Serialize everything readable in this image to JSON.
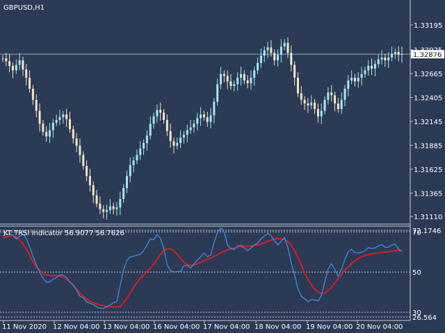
{
  "window": {
    "symbol_label": "GBPUSD,H1"
  },
  "colors": {
    "background": "#2b3a55",
    "axis": "#c8cdd6",
    "candle_up": "#a8e6ee",
    "candle_down": "#f3e6c6",
    "tsi_line": "#3f8de6",
    "signal_line": "#e11b1b",
    "price_line": "#9aa3b0"
  },
  "price_panel": {
    "current_price": "1.32876",
    "y_ticks": [
      "1.33195",
      "1.32925",
      "1.32665",
      "1.32405",
      "1.32145",
      "1.31885",
      "1.31625",
      "1.31365",
      "1.31110"
    ]
  },
  "indicator_panel": {
    "title": "KT TRSI Indicator 56.9077 56.7626",
    "y_ticks": [
      "72.1746",
      "70",
      "50",
      "30",
      "26.564"
    ],
    "levels": [
      70,
      50,
      30
    ]
  },
  "x_axis": {
    "labels": [
      "11 Nov 2020",
      "12 Nov 04:00",
      "13 Nov 04:00",
      "16 Nov 04:00",
      "17 Nov 04:00",
      "18 Nov 04:00",
      "19 Nov 04:00",
      "20 Nov 04:00"
    ]
  },
  "chart_data": [
    {
      "type": "candlestick",
      "title": "GBPUSD,H1",
      "ylim": [
        1.3105,
        1.333
      ],
      "current_price": 1.32876,
      "close": [
        1.3283,
        1.328,
        1.3275,
        1.327,
        1.3276,
        1.3281,
        1.3271,
        1.3262,
        1.325,
        1.3238,
        1.3226,
        1.3212,
        1.3203,
        1.3198,
        1.3205,
        1.3213,
        1.3216,
        1.3219,
        1.3222,
        1.3217,
        1.3206,
        1.3196,
        1.3188,
        1.3178,
        1.3166,
        1.3155,
        1.3145,
        1.3134,
        1.3125,
        1.3119,
        1.3116,
        1.3118,
        1.3122,
        1.3119,
        1.3121,
        1.313,
        1.3142,
        1.3155,
        1.3167,
        1.3172,
        1.3178,
        1.3185,
        1.3191,
        1.3199,
        1.3212,
        1.322,
        1.3227,
        1.3224,
        1.3216,
        1.3204,
        1.3193,
        1.3188,
        1.3191,
        1.3197,
        1.32,
        1.3205,
        1.3208,
        1.3212,
        1.3218,
        1.3222,
        1.3219,
        1.3214,
        1.3221,
        1.3236,
        1.3255,
        1.3266,
        1.3264,
        1.3258,
        1.3253,
        1.3255,
        1.3262,
        1.3266,
        1.3259,
        1.3256,
        1.3262,
        1.327,
        1.3278,
        1.3286,
        1.3292,
        1.3295,
        1.3289,
        1.3281,
        1.3287,
        1.3296,
        1.33,
        1.3289,
        1.3276,
        1.3262,
        1.3245,
        1.3238,
        1.3234,
        1.3232,
        1.3235,
        1.3228,
        1.322,
        1.3226,
        1.3238,
        1.3246,
        1.3243,
        1.3234,
        1.3228,
        1.3238,
        1.325,
        1.3259,
        1.3262,
        1.3258,
        1.3262,
        1.3266,
        1.327,
        1.3275,
        1.3272,
        1.3277,
        1.3282,
        1.3284,
        1.3281,
        1.3284,
        1.3288,
        1.329,
        1.3287,
        1.3288
      ]
    },
    {
      "type": "line",
      "title": "KT TRSI Indicator 56.9077 56.7626",
      "ylim": [
        26.564,
        72.1746
      ],
      "levels": [
        70,
        50,
        30
      ],
      "series": [
        {
          "values": [
            68.0,
            68.7,
            69.1,
            68.4,
            66.5,
            67.7,
            69.0,
            66.8,
            62.6,
            57.9,
            53.5,
            50.0,
            47.0,
            44.9,
            45.0,
            46.5,
            47.2,
            48.6,
            48.5,
            47.4,
            45.0,
            43.7,
            41.0,
            38.0,
            37.2,
            35.2,
            34.4,
            33.9,
            32.6,
            32.0,
            31.9,
            32.6,
            33.6,
            34.8,
            35.2,
            43.3,
            51.1,
            55.8,
            57.5,
            57.9,
            58.4,
            58.9,
            60.6,
            63.4,
            66.5,
            66.1,
            68.7,
            66.8,
            62.0,
            53.6,
            50.7,
            50.1,
            50.2,
            50.3,
            53.2,
            53.3,
            52.0,
            54.0,
            56.0,
            57.6,
            59.5,
            57.7,
            58.5,
            64.6,
            69.7,
            72.0,
            69.9,
            63.5,
            61.6,
            61.3,
            63.1,
            63.4,
            62.0,
            60.6,
            62.0,
            63.5,
            64.5,
            66.6,
            67.9,
            69.2,
            68.1,
            65.6,
            63.5,
            65.3,
            67.2,
            62.2,
            54.6,
            48.8,
            41.5,
            37.9,
            36.7,
            35.3,
            36.3,
            36.1,
            35.6,
            38.3,
            45.2,
            51.4,
            54.2,
            51.2,
            47.8,
            51.5,
            56.2,
            60.1,
            61.4,
            59.7,
            59.5,
            59.9,
            60.6,
            62.2,
            61.7,
            62.0,
            63.0,
            63.6,
            62.4,
            62.4,
            63.5,
            63.9,
            61.4,
            60.3
          ]
        },
        {
          "values": [
            67.0,
            67.5,
            68.0,
            68.2,
            67.3,
            66.0,
            64.2,
            61.5,
            58.4,
            55.0,
            52.5,
            50.7,
            49.4,
            48.6,
            48.2,
            48.2,
            48.3,
            48.1,
            47.4,
            46.4,
            45.0,
            43.3,
            41.5,
            39.6,
            38.0,
            36.6,
            35.5,
            34.7,
            34.1,
            33.6,
            33.3,
            33.0,
            32.7,
            32.6,
            32.5,
            32.9,
            34.6,
            37.1,
            39.6,
            42.3,
            44.8,
            46.9,
            48.6,
            50.2,
            51.9,
            53.8,
            56.3,
            58.8,
            60.7,
            61.6,
            61.5,
            60.6,
            58.8,
            56.7,
            54.9,
            53.7,
            53.3,
            53.5,
            54.1,
            54.8,
            55.6,
            56.4,
            57.1,
            57.8,
            58.7,
            59.6,
            60.4,
            61.1,
            61.7,
            62.0,
            62.3,
            62.6,
            62.8,
            62.9,
            63.0,
            63.2,
            63.5,
            64.0,
            64.6,
            65.3,
            65.9,
            66.4,
            66.7,
            66.6,
            66.2,
            65.2,
            63.4,
            60.7,
            57.3,
            53.6,
            49.8,
            46.5,
            43.6,
            41.5,
            40.0,
            39.4,
            39.6,
            40.8,
            42.6,
            44.6,
            46.8,
            48.9,
            50.8,
            52.6,
            54.2,
            55.6,
            56.8,
            57.6,
            58.3,
            58.7,
            59.0,
            59.3,
            59.5,
            59.8,
            60.0,
            60.2,
            60.4,
            60.6,
            60.7,
            60.8
          ]
        }
      ]
    }
  ]
}
